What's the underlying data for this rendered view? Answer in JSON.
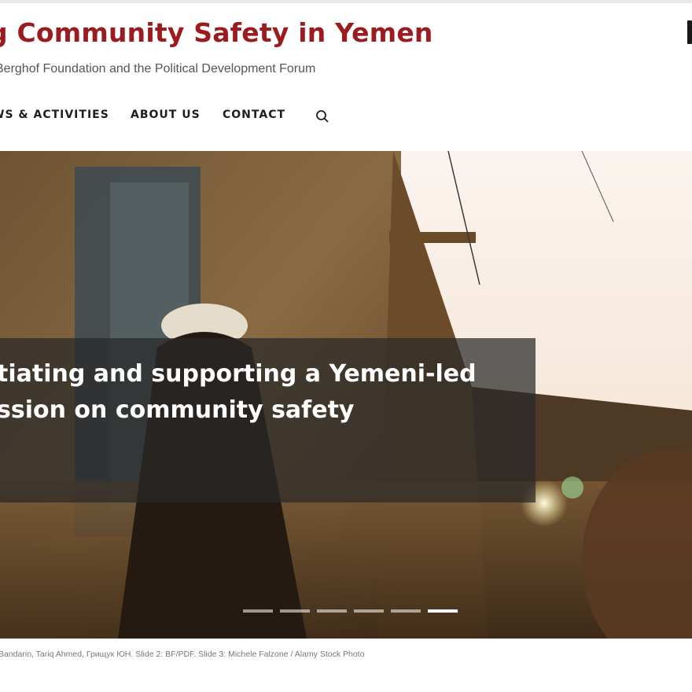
{
  "header": {
    "title": "g Community Safety in Yemen",
    "tagline": "Berghof Foundation and the Political Development Forum"
  },
  "nav": {
    "items": [
      {
        "label": "WS & ACTIVITIES"
      },
      {
        "label": "ABOUT US"
      },
      {
        "label": "CONTACT"
      }
    ],
    "search_icon": "search-icon"
  },
  "hero": {
    "caption_line1": "tiating and supporting a Yemeni-led",
    "caption_line2": "ssion on community safety",
    "slide_count": 6,
    "active_slide": 6
  },
  "footer": {
    "credit": "Bandarin, Tariq Ahmed, Грищук ЮН. Slide 2: BF/PDF. Slide 3: Michele Falzone / Alamy Stock Photo"
  },
  "colors": {
    "title": "#9b1b1f",
    "nav_text": "#1e1e1e",
    "caption_overlay": "#282828",
    "background": "#ffffff"
  }
}
